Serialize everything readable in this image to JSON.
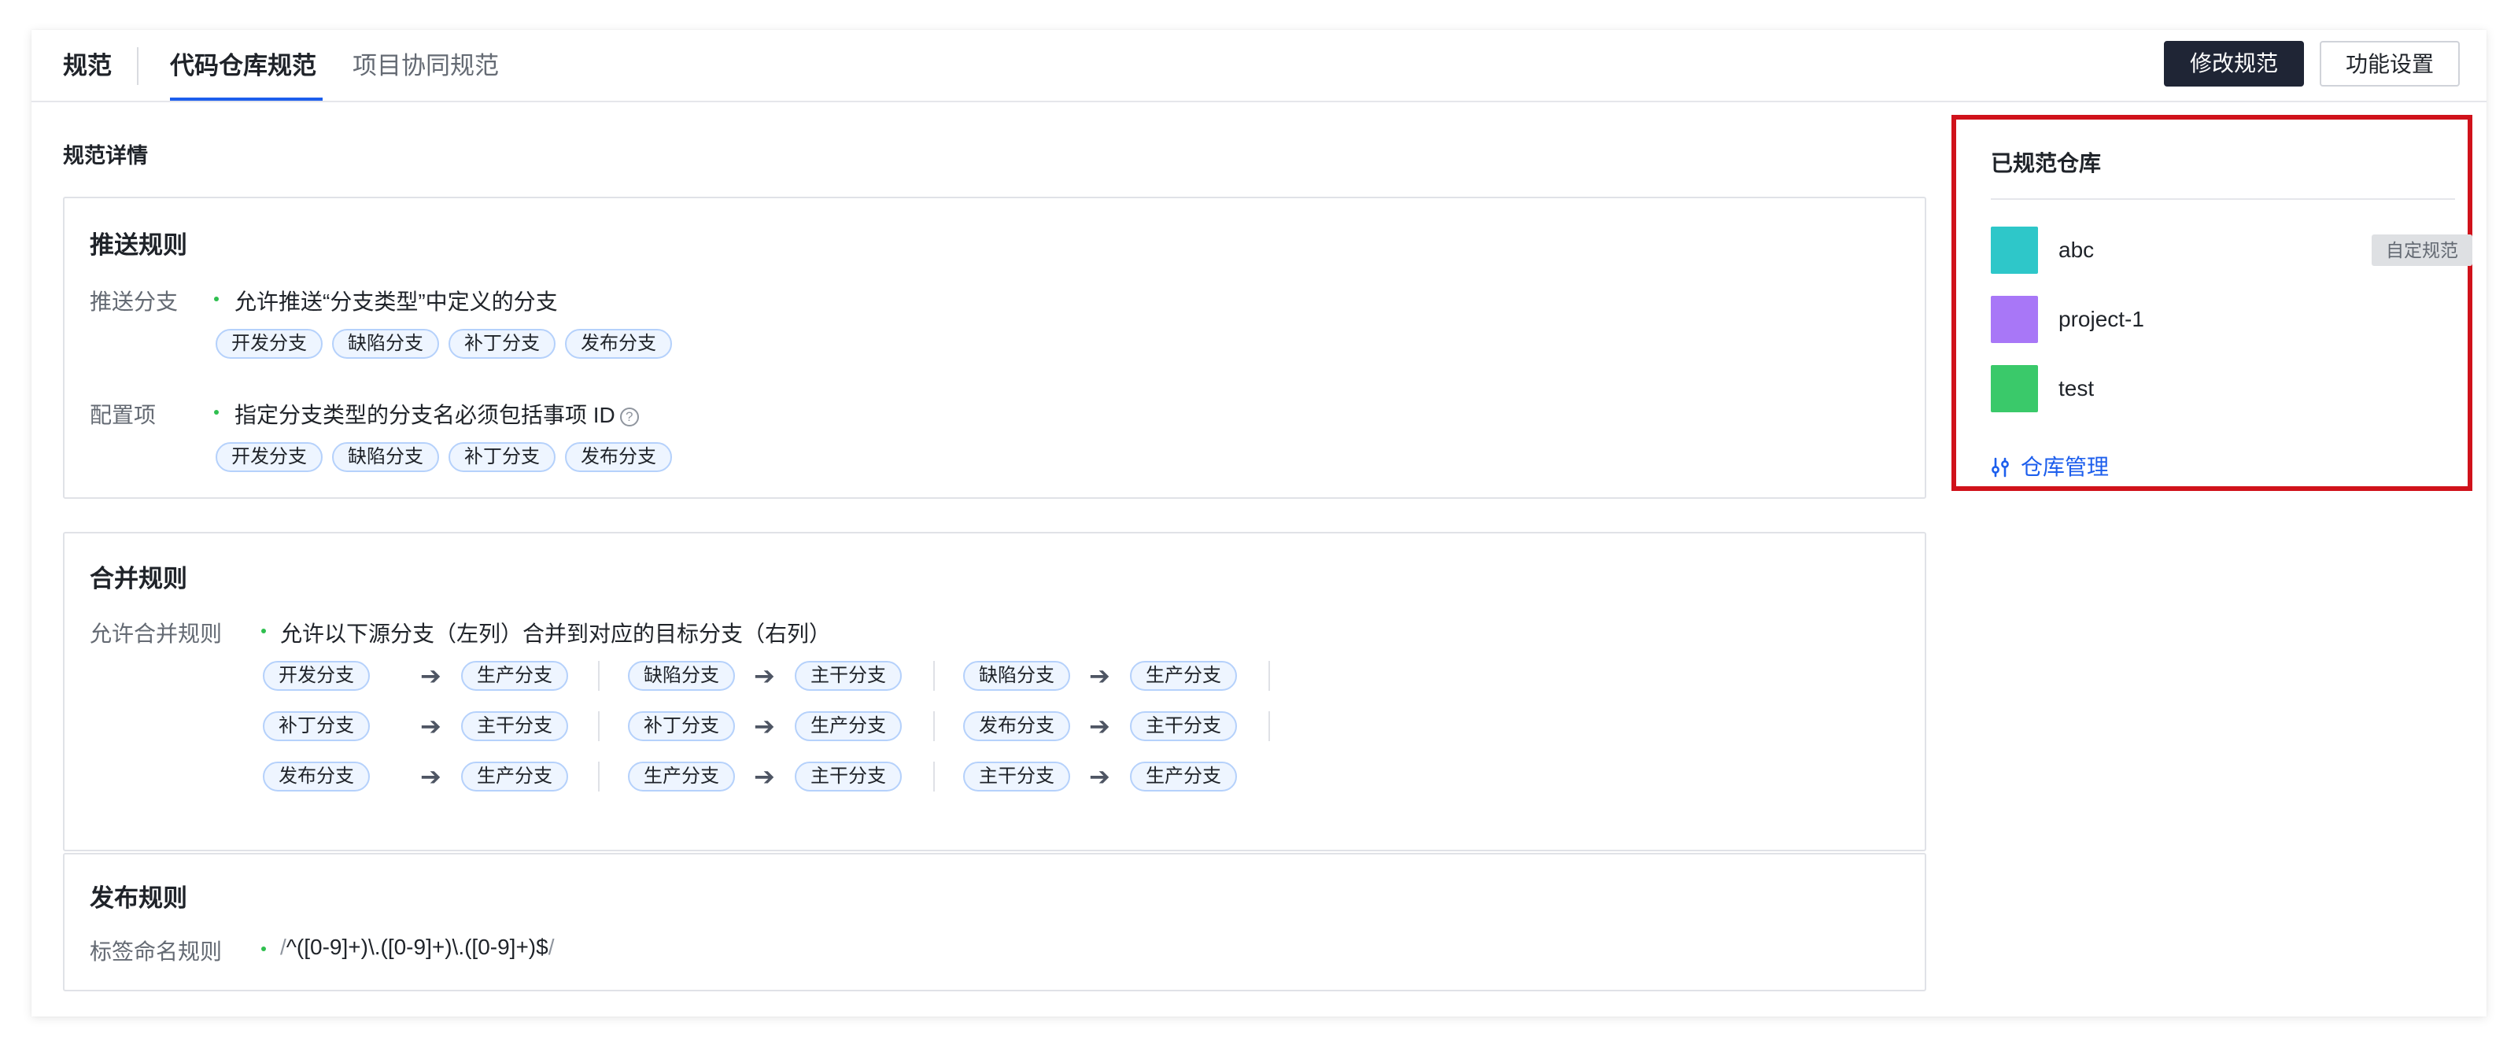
{
  "header": {
    "breadcrumb": "规范",
    "tabs": [
      {
        "label": "代码仓库规范",
        "active": true
      },
      {
        "label": "项目协同规范",
        "active": false
      }
    ],
    "edit_button": "修改规范",
    "settings_button": "功能设置"
  },
  "detail_title": "规范详情",
  "push_rules": {
    "title": "推送规则",
    "branch_label": "推送分支",
    "branch_text": "允许推送“分支类型”中定义的分支",
    "branch_tags": [
      "开发分支",
      "缺陷分支",
      "补丁分支",
      "发布分支"
    ],
    "config_label": "配置项",
    "config_text": "指定分支类型的分支名必须包括事项 ID",
    "config_help_icon": "question-circle-icon",
    "config_tags": [
      "开发分支",
      "缺陷分支",
      "补丁分支",
      "发布分支"
    ]
  },
  "merge_rules": {
    "title": "合并规则",
    "label": "允许合并规则",
    "text": "允许以下源分支（左列）合并到对应的目标分支（右列）",
    "arrow_icon": "arrow-right-icon",
    "pairs": [
      [
        {
          "from": "开发分支",
          "to": "生产分支"
        },
        {
          "from": "缺陷分支",
          "to": "主干分支"
        },
        {
          "from": "缺陷分支",
          "to": "生产分支"
        }
      ],
      [
        {
          "from": "补丁分支",
          "to": "主干分支"
        },
        {
          "from": "补丁分支",
          "to": "生产分支"
        },
        {
          "from": "发布分支",
          "to": "主干分支"
        }
      ],
      [
        {
          "from": "发布分支",
          "to": "生产分支"
        },
        {
          "from": "生产分支",
          "to": "主干分支"
        },
        {
          "from": "主干分支",
          "to": "生产分支"
        }
      ]
    ]
  },
  "release_rules": {
    "title": "发布规则",
    "label": "标签命名规则",
    "slash": "/",
    "regex": "^([0-9]+)\\.([0-9]+)\\.([0-9]+)$"
  },
  "repos": {
    "title": "已规范仓库",
    "items": [
      {
        "name": "abc",
        "color": "#2ec7c9",
        "badge": "自定规范"
      },
      {
        "name": "project-1",
        "color": "#a877f7",
        "badge": ""
      },
      {
        "name": "test",
        "color": "#3ac96a",
        "badge": ""
      }
    ],
    "manage_link": "仓库管理",
    "manage_icon": "sliders-icon"
  }
}
